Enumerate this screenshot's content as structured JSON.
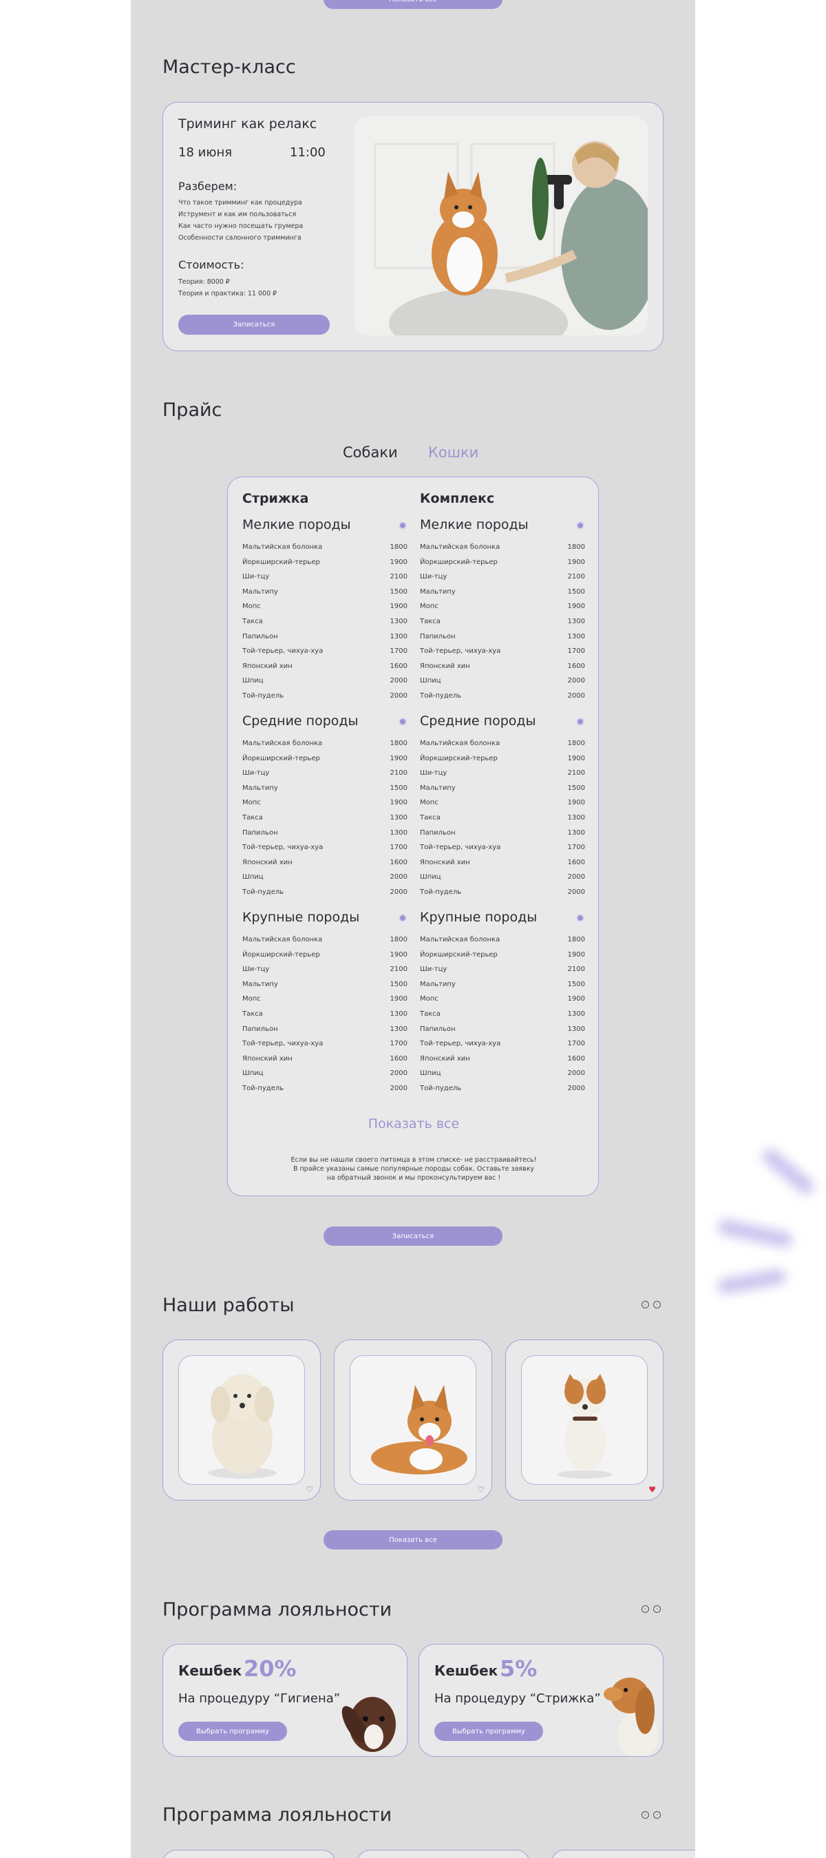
{
  "top_button": {
    "label": "Показать все"
  },
  "master_class": {
    "section_title": "Мастер-класс",
    "card_title": "Триминг как релакс",
    "date": "18 июня",
    "time": "11:00",
    "learn_title": "Разберем:",
    "learn_items": [
      "Что такое тримминг как процедура",
      "Иструмент и как им пользоваться",
      "Как часто нужно посещать грумера",
      "Особенности салонного тримминга"
    ],
    "price_title": "Стоимость:",
    "prices": [
      "Теория: 8000 ₽",
      "Теория и практика: 11 000 ₽"
    ],
    "signup_label": "Записаться"
  },
  "price": {
    "section_title": "Прайс",
    "tabs": [
      {
        "label": "Собаки",
        "active": true
      },
      {
        "label": "Кошки",
        "active": false
      }
    ],
    "columns": [
      "Стрижка",
      "Комплекс"
    ],
    "categories": [
      "Мелкие породы",
      "Средние породы",
      "Крупные породы"
    ],
    "breeds": [
      {
        "name": "Мальтийская болонка",
        "price": "1800"
      },
      {
        "name": "Йоркширский-терьер",
        "price": "1900"
      },
      {
        "name": "Ши-тцу",
        "price": "2100"
      },
      {
        "name": "Мальтипу",
        "price": "1500"
      },
      {
        "name": "Мопс",
        "price": "1900"
      },
      {
        "name": "Такса",
        "price": "1300"
      },
      {
        "name": "Папильон",
        "price": "1300"
      },
      {
        "name": "Той-терьер, чихуа-хуа",
        "price": "1700"
      },
      {
        "name": "Японский хин",
        "price": "1600"
      },
      {
        "name": "Шпиц",
        "price": "2000"
      },
      {
        "name": "Той-пудель",
        "price": "2000"
      }
    ],
    "show_all": "Показать все",
    "note_lines": [
      "Если вы не нашли своего питомца в этом списке- не расстраивайтесь!",
      "В прайсе указаны самые популярные породы собак. Оставьте заявку",
      "на обратный звонок и мы проконсультируем вас !"
    ],
    "signup_label": "Записаться"
  },
  "works": {
    "section_title": "Наши работы",
    "items": [
      {
        "name": "poodle-photo",
        "liked": false
      },
      {
        "name": "corgi-photo",
        "liked": false
      },
      {
        "name": "terrier-photo",
        "liked": true
      }
    ],
    "show_all": "Показать все"
  },
  "loyalty": {
    "section_title": "Программа лояльности",
    "cards": [
      {
        "label": "Кешбек",
        "percent": "20%",
        "desc": "На процедуру “Гигиена”",
        "button": "Выбрать программу"
      },
      {
        "label": "Кешбек",
        "percent": "5%",
        "desc": "На процедуру “Стрижка”",
        "button": "Выбрать программу"
      }
    ]
  },
  "loyalty2": {
    "section_title": "Программа лояльности"
  },
  "colors": {
    "accent": "#9d93d3",
    "background": "#dcdcdc",
    "card": "#e9e9e9",
    "heart": "#d9354a"
  }
}
